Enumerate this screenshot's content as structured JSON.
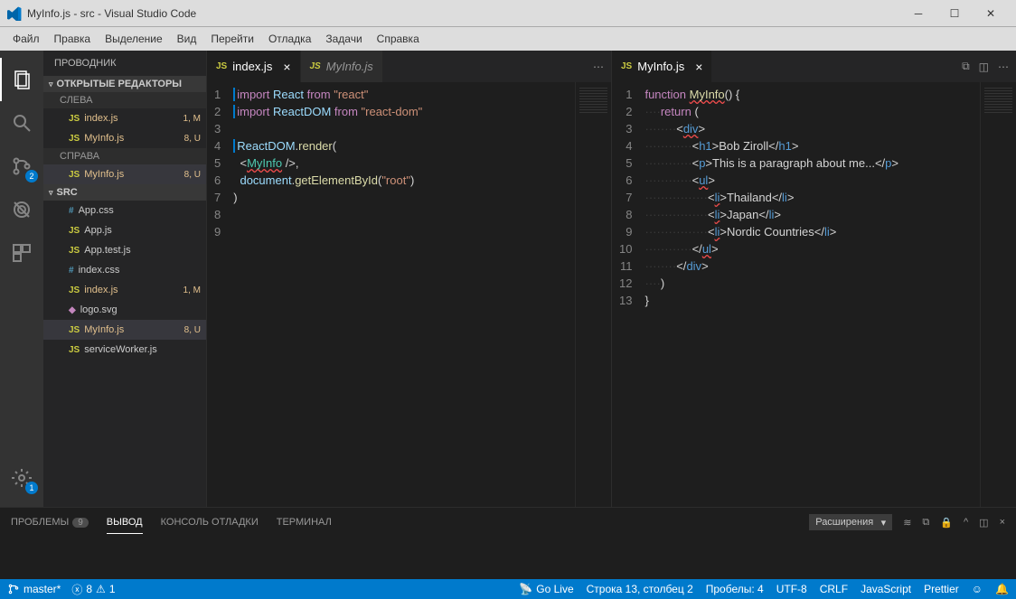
{
  "title": "MyInfo.js - src - Visual Studio Code",
  "menu": [
    "Файл",
    "Правка",
    "Выделение",
    "Вид",
    "Перейти",
    "Отладка",
    "Задачи",
    "Справка"
  ],
  "activity": {
    "scm_badge": "2",
    "gear_badge": "1"
  },
  "sidebar": {
    "title": "ПРОВОДНИК",
    "open_editors_label": "ОТКРЫТЫЕ РЕДАКТОРЫ",
    "left_label": "СЛЕВА",
    "right_label": "СПРАВА",
    "src_label": "SRC",
    "open_left": [
      {
        "name": "index.js",
        "status": "1, M"
      },
      {
        "name": "MyInfo.js",
        "status": "8, U"
      }
    ],
    "open_right": [
      {
        "name": "MyInfo.js",
        "status": "8, U"
      }
    ],
    "files": [
      {
        "name": "App.css",
        "icon": "css"
      },
      {
        "name": "App.js",
        "icon": "js"
      },
      {
        "name": "App.test.js",
        "icon": "js"
      },
      {
        "name": "index.css",
        "icon": "css"
      },
      {
        "name": "index.js",
        "icon": "js",
        "status": "1, M",
        "class": "mod"
      },
      {
        "name": "logo.svg",
        "icon": "svg"
      },
      {
        "name": "MyInfo.js",
        "icon": "js",
        "status": "8, U",
        "class": "mod active"
      },
      {
        "name": "serviceWorker.js",
        "icon": "js"
      }
    ]
  },
  "editor_left": {
    "tabs": [
      {
        "label": "index.js",
        "active": true
      },
      {
        "label": "MyInfo.js",
        "active": false,
        "italic": true
      }
    ],
    "line_count": 9
  },
  "editor_right": {
    "tabs": [
      {
        "label": "MyInfo.js",
        "active": true
      }
    ],
    "line_count": 13
  },
  "panel": {
    "tabs": [
      {
        "label": "ПРОБЛЕМЫ",
        "badge": "9"
      },
      {
        "label": "ВЫВОД",
        "active": true
      },
      {
        "label": "КОНСОЛЬ ОТЛАДКИ"
      },
      {
        "label": "ТЕРМИНАЛ"
      }
    ],
    "select": "Расширения"
  },
  "status": {
    "branch": "master*",
    "errors": "8",
    "warnings": "1",
    "golive": "Go Live",
    "cursor": "Строка 13, столбец 2",
    "spaces": "Пробелы: 4",
    "encoding": "UTF-8",
    "eol": "CRLF",
    "lang": "JavaScript",
    "prettier": "Prettier"
  }
}
